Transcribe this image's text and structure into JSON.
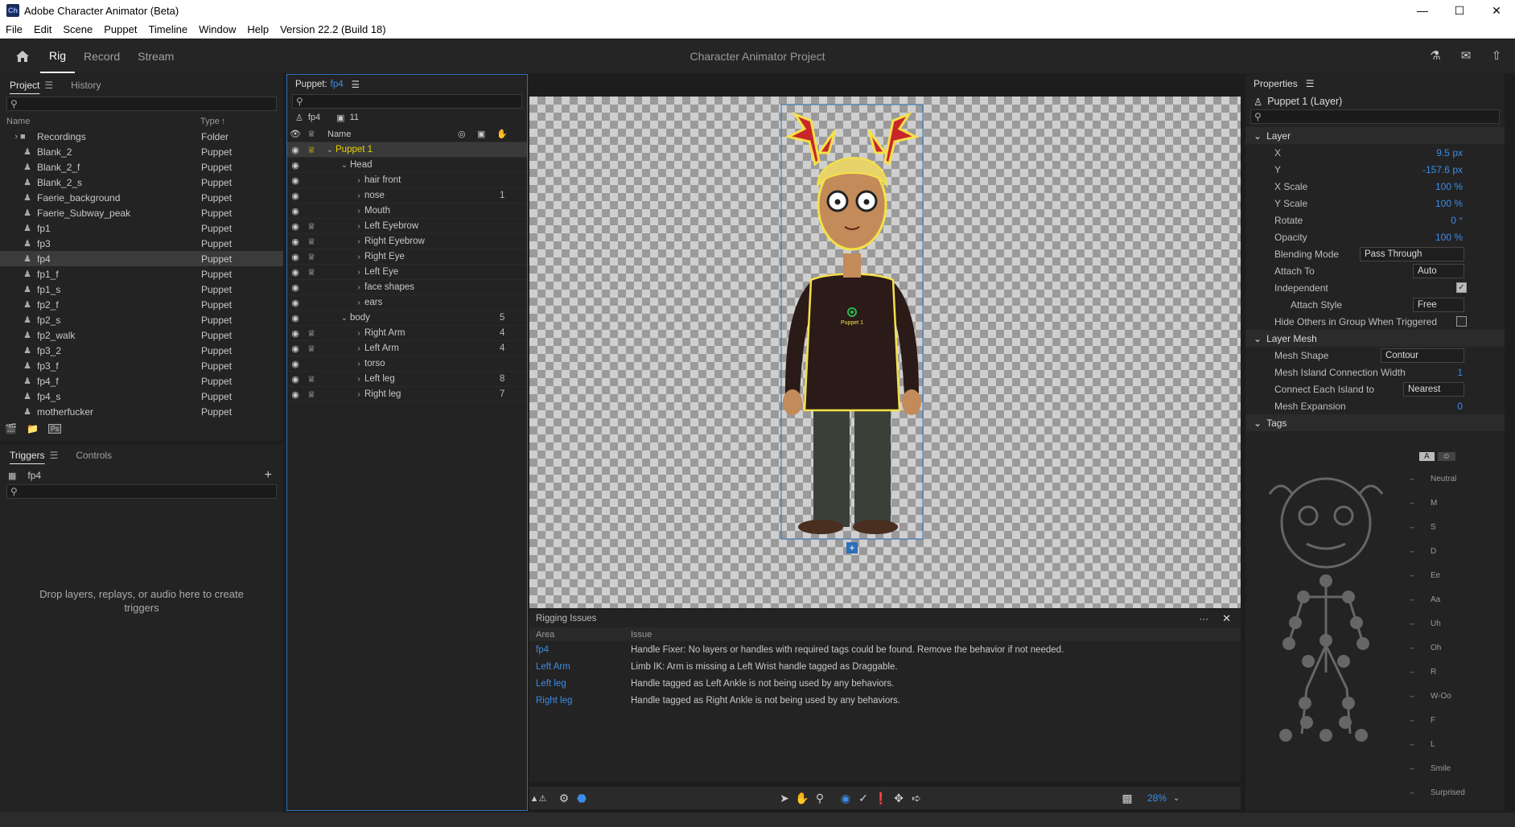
{
  "window": {
    "title": "Adobe Character Animator (Beta)",
    "logo": "Ch"
  },
  "menu": [
    "File",
    "Edit",
    "Scene",
    "Puppet",
    "Timeline",
    "Window",
    "Help",
    "Version 22.2 (Build 18)"
  ],
  "modes": [
    "Rig",
    "Record",
    "Stream"
  ],
  "project_title": "Character Animator Project",
  "project": {
    "tabs": [
      "Project",
      "History"
    ],
    "col_name": "Name",
    "col_type": "Type",
    "items": [
      {
        "name": "Recordings",
        "type": "Folder"
      },
      {
        "name": "Blank_2",
        "type": "Puppet"
      },
      {
        "name": "Blank_2_f",
        "type": "Puppet"
      },
      {
        "name": "Blank_2_s",
        "type": "Puppet"
      },
      {
        "name": "Faerie_background",
        "type": "Puppet"
      },
      {
        "name": "Faerie_Subway_peak",
        "type": "Puppet"
      },
      {
        "name": "fp1",
        "type": "Puppet"
      },
      {
        "name": "fp3",
        "type": "Puppet"
      },
      {
        "name": "fp4",
        "type": "Puppet"
      },
      {
        "name": "fp1_f",
        "type": "Puppet"
      },
      {
        "name": "fp1_s",
        "type": "Puppet"
      },
      {
        "name": "fp2_f",
        "type": "Puppet"
      },
      {
        "name": "fp2_s",
        "type": "Puppet"
      },
      {
        "name": "fp2_walk",
        "type": "Puppet"
      },
      {
        "name": "fp3_2",
        "type": "Puppet"
      },
      {
        "name": "fp3_f",
        "type": "Puppet"
      },
      {
        "name": "fp4_f",
        "type": "Puppet"
      },
      {
        "name": "fp4_s",
        "type": "Puppet"
      },
      {
        "name": "motherfucker",
        "type": "Puppet"
      }
    ],
    "footer_ps": "Ps"
  },
  "triggers": {
    "tabs": [
      "Triggers",
      "Controls"
    ],
    "puppet": "fp4",
    "empty": "Drop layers, replays, or audio here to create triggers"
  },
  "puppet_panel": {
    "title": "Puppet:",
    "puppet": "fp4",
    "count": "11",
    "col_name": "Name",
    "layers": [
      {
        "name": "Puppet 1",
        "num": "",
        "crown": true,
        "depth": 0,
        "expanded": true
      },
      {
        "name": "Head",
        "num": "",
        "crown": false,
        "depth": 1,
        "expanded": true
      },
      {
        "name": "hair front",
        "num": "",
        "crown": false,
        "depth": 2
      },
      {
        "name": "nose",
        "num": "1",
        "crown": false,
        "depth": 2
      },
      {
        "name": "Mouth",
        "num": "",
        "crown": false,
        "depth": 2
      },
      {
        "name": "Left Eyebrow",
        "num": "",
        "crown": true,
        "depth": 2
      },
      {
        "name": "Right Eyebrow",
        "num": "",
        "crown": true,
        "depth": 2
      },
      {
        "name": "Right Eye",
        "num": "",
        "crown": true,
        "depth": 2
      },
      {
        "name": "Left Eye",
        "num": "",
        "crown": true,
        "depth": 2
      },
      {
        "name": "face shapes",
        "num": "",
        "crown": false,
        "depth": 2
      },
      {
        "name": "ears",
        "num": "",
        "crown": false,
        "depth": 2
      },
      {
        "name": "body",
        "num": "5",
        "crown": false,
        "depth": 1,
        "expanded": true
      },
      {
        "name": "Right Arm",
        "num": "4",
        "crown": true,
        "depth": 2
      },
      {
        "name": "Left Arm",
        "num": "4",
        "crown": true,
        "depth": 2
      },
      {
        "name": "torso",
        "num": "",
        "crown": false,
        "depth": 2
      },
      {
        "name": "Left leg",
        "num": "8",
        "crown": true,
        "depth": 2
      },
      {
        "name": "Right leg",
        "num": "7",
        "crown": true,
        "depth": 2
      }
    ]
  },
  "canvas": {
    "puppet_label": "Puppet 1",
    "zoom": "28%"
  },
  "rigging": {
    "title": "Rigging Issues",
    "col_area": "Area",
    "col_issue": "Issue",
    "rows": [
      {
        "area": "fp4",
        "issue": "Handle Fixer: No layers or handles with required tags could be found. Remove the behavior if not needed."
      },
      {
        "area": "Left Arm",
        "issue": "Limb IK: Arm is missing a Left Wrist handle tagged as Draggable."
      },
      {
        "area": "Left leg",
        "issue": "Handle tagged as Left Ankle is not being used by any behaviors."
      },
      {
        "area": "Right leg",
        "issue": "Handle tagged as Right Ankle is not being used by any behaviors."
      }
    ]
  },
  "properties": {
    "tab": "Properties",
    "layer_name": "Puppet 1 (Layer)",
    "sec_layer": "Layer",
    "x_label": "X",
    "x": "9.5 px",
    "y_label": "Y",
    "y": "-157.6 px",
    "xs_label": "X Scale",
    "xs": "100 %",
    "ys_label": "Y Scale",
    "ys": "100 %",
    "rot_label": "Rotate",
    "rot": "0 °",
    "op_label": "Opacity",
    "op": "100 %",
    "blend_label": "Blending Mode",
    "blend": "Pass Through",
    "attach_label": "Attach To",
    "attach": "Auto",
    "indep_label": "Independent",
    "style_label": "Attach Style",
    "style": "Free",
    "hide_label": "Hide Others in Group When Triggered",
    "sec_mesh": "Layer Mesh",
    "mesh_shape_label": "Mesh Shape",
    "mesh_shape": "Contour",
    "island_label": "Mesh Island Connection Width",
    "island": "1",
    "connect_label": "Connect Each Island to",
    "connect": "Nearest",
    "exp_label": "Mesh Expansion",
    "exp": "0",
    "sec_tags": "Tags",
    "tag_toggle": "A",
    "tags": [
      "Neutral",
      "M",
      "S",
      "D",
      "Ee",
      "Aa",
      "Uh",
      "Oh",
      "R",
      "W-Oo",
      "F",
      "L",
      "Smile",
      "Surprised"
    ]
  }
}
